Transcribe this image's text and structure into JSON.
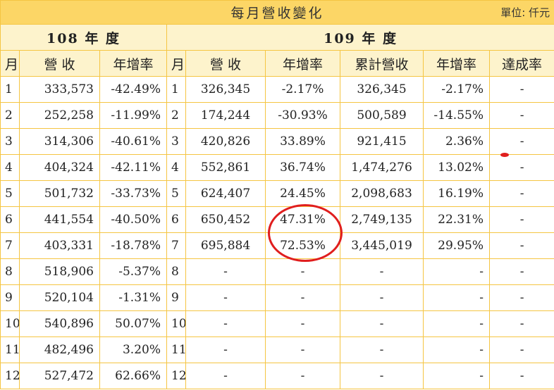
{
  "title": "每月營收變化",
  "unit": "單位: 仟元",
  "year108": "108 年 度",
  "year109": "109 年 度",
  "headers": {
    "month": "月",
    "revenue": "營 收",
    "yoy": "年增率",
    "month2": "月",
    "revenue2": "營 收",
    "yoy2": "年增率",
    "cumulative": "累計營收",
    "cum_yoy": "年增率",
    "achievement": "達成率"
  },
  "rows": [
    {
      "m108": "1",
      "rev108": "333,573",
      "yoy108": "-42.49%",
      "m109": "1",
      "rev109": "326,345",
      "yoy109": "-2.17%",
      "cum": "326,345",
      "cumyoy": "-2.17%",
      "ach": "-"
    },
    {
      "m108": "2",
      "rev108": "252,258",
      "yoy108": "-11.99%",
      "m109": "2",
      "rev109": "174,244",
      "yoy109": "-30.93%",
      "cum": "500,589",
      "cumyoy": "-14.55%",
      "ach": "-"
    },
    {
      "m108": "3",
      "rev108": "314,306",
      "yoy108": "-40.61%",
      "m109": "3",
      "rev109": "420,826",
      "yoy109": "33.89%",
      "cum": "921,415",
      "cumyoy": "2.36%",
      "ach": "-"
    },
    {
      "m108": "4",
      "rev108": "404,324",
      "yoy108": "-42.11%",
      "m109": "4",
      "rev109": "552,861",
      "yoy109": "36.74%",
      "cum": "1,474,276",
      "cumyoy": "13.02%",
      "ach": "-"
    },
    {
      "m108": "5",
      "rev108": "501,732",
      "yoy108": "-33.73%",
      "m109": "5",
      "rev109": "624,407",
      "yoy109": "24.45%",
      "cum": "2,098,683",
      "cumyoy": "16.19%",
      "ach": "-"
    },
    {
      "m108": "6",
      "rev108": "441,554",
      "yoy108": "-40.50%",
      "m109": "6",
      "rev109": "650,452",
      "yoy109": "47.31%",
      "cum": "2,749,135",
      "cumyoy": "22.31%",
      "ach": "-"
    },
    {
      "m108": "7",
      "rev108": "403,331",
      "yoy108": "-18.78%",
      "m109": "7",
      "rev109": "695,884",
      "yoy109": "72.53%",
      "cum": "3,445,019",
      "cumyoy": "29.95%",
      "ach": "-"
    },
    {
      "m108": "8",
      "rev108": "518,906",
      "yoy108": "-5.37%",
      "m109": "8",
      "rev109": "-",
      "yoy109": "-",
      "cum": "-",
      "cumyoy": "-",
      "ach": "-"
    },
    {
      "m108": "9",
      "rev108": "520,104",
      "yoy108": "-1.31%",
      "m109": "9",
      "rev109": "-",
      "yoy109": "-",
      "cum": "-",
      "cumyoy": "-",
      "ach": "-"
    },
    {
      "m108": "10",
      "rev108": "540,896",
      "yoy108": "50.07%",
      "m109": "10",
      "rev109": "-",
      "yoy109": "-",
      "cum": "-",
      "cumyoy": "-",
      "ach": "-"
    },
    {
      "m108": "11",
      "rev108": "482,496",
      "yoy108": "3.20%",
      "m109": "11",
      "rev109": "-",
      "yoy109": "-",
      "cum": "-",
      "cumyoy": "-",
      "ach": "-"
    },
    {
      "m108": "12",
      "rev108": "527,472",
      "yoy108": "62.66%",
      "m109": "12",
      "rev109": "-",
      "yoy109": "-",
      "cum": "-",
      "cumyoy": "-",
      "ach": "-"
    }
  ],
  "annotation_color": "#e01e1e"
}
